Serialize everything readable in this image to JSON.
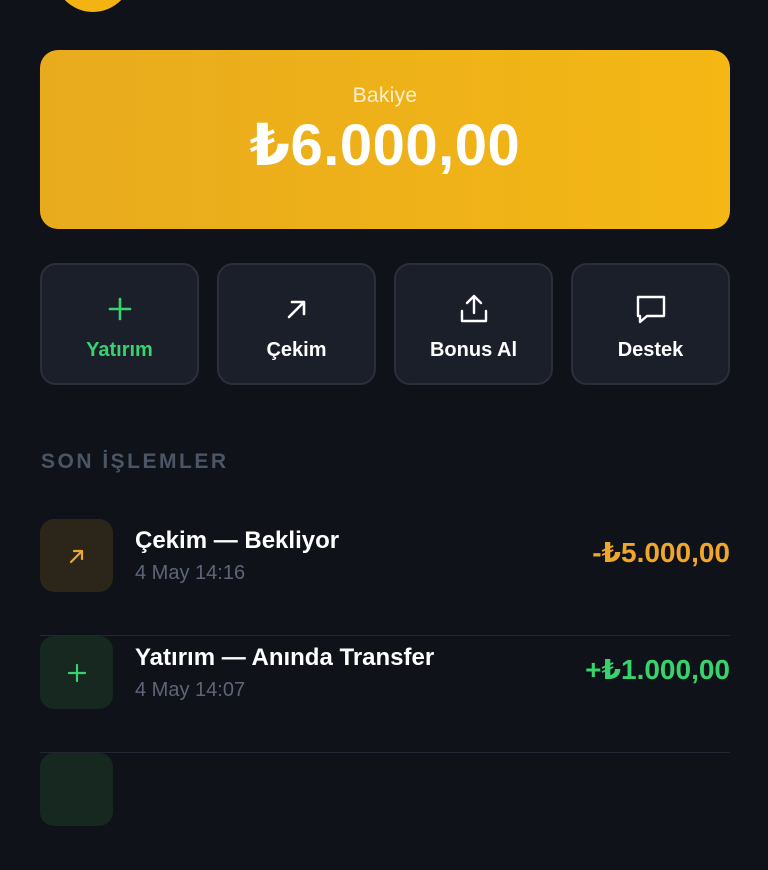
{
  "balance": {
    "label": "Bakiye",
    "amount": "₺6.000,00"
  },
  "actions": [
    {
      "label": "Yatırım",
      "icon": "plus-icon",
      "color": "#38d26f"
    },
    {
      "label": "Çekim",
      "icon": "arrow-up-right-icon",
      "color": "#ffffff"
    },
    {
      "label": "Bonus Al",
      "icon": "share-upload-icon",
      "color": "#ffffff"
    },
    {
      "label": "Destek",
      "icon": "chat-bubble-icon",
      "color": "#ffffff"
    }
  ],
  "recent": {
    "title": "SON İŞLEMLER",
    "items": [
      {
        "title": "Çekim — Bekliyor",
        "time": "4 May 14:16",
        "amount": "-₺5.000,00",
        "amount_color": "#f0a62b",
        "icon": "arrow-up-right-icon"
      },
      {
        "title": "Yatırım — Anında Transfer",
        "time": "4 May 14:07",
        "amount": "+₺1.000,00",
        "amount_color": "#38d26f",
        "icon": "plus-icon"
      }
    ]
  },
  "colors": {
    "background": "#0f1218",
    "accent": "#f4b714",
    "positive": "#38d26f",
    "pending": "#f0a62b"
  }
}
